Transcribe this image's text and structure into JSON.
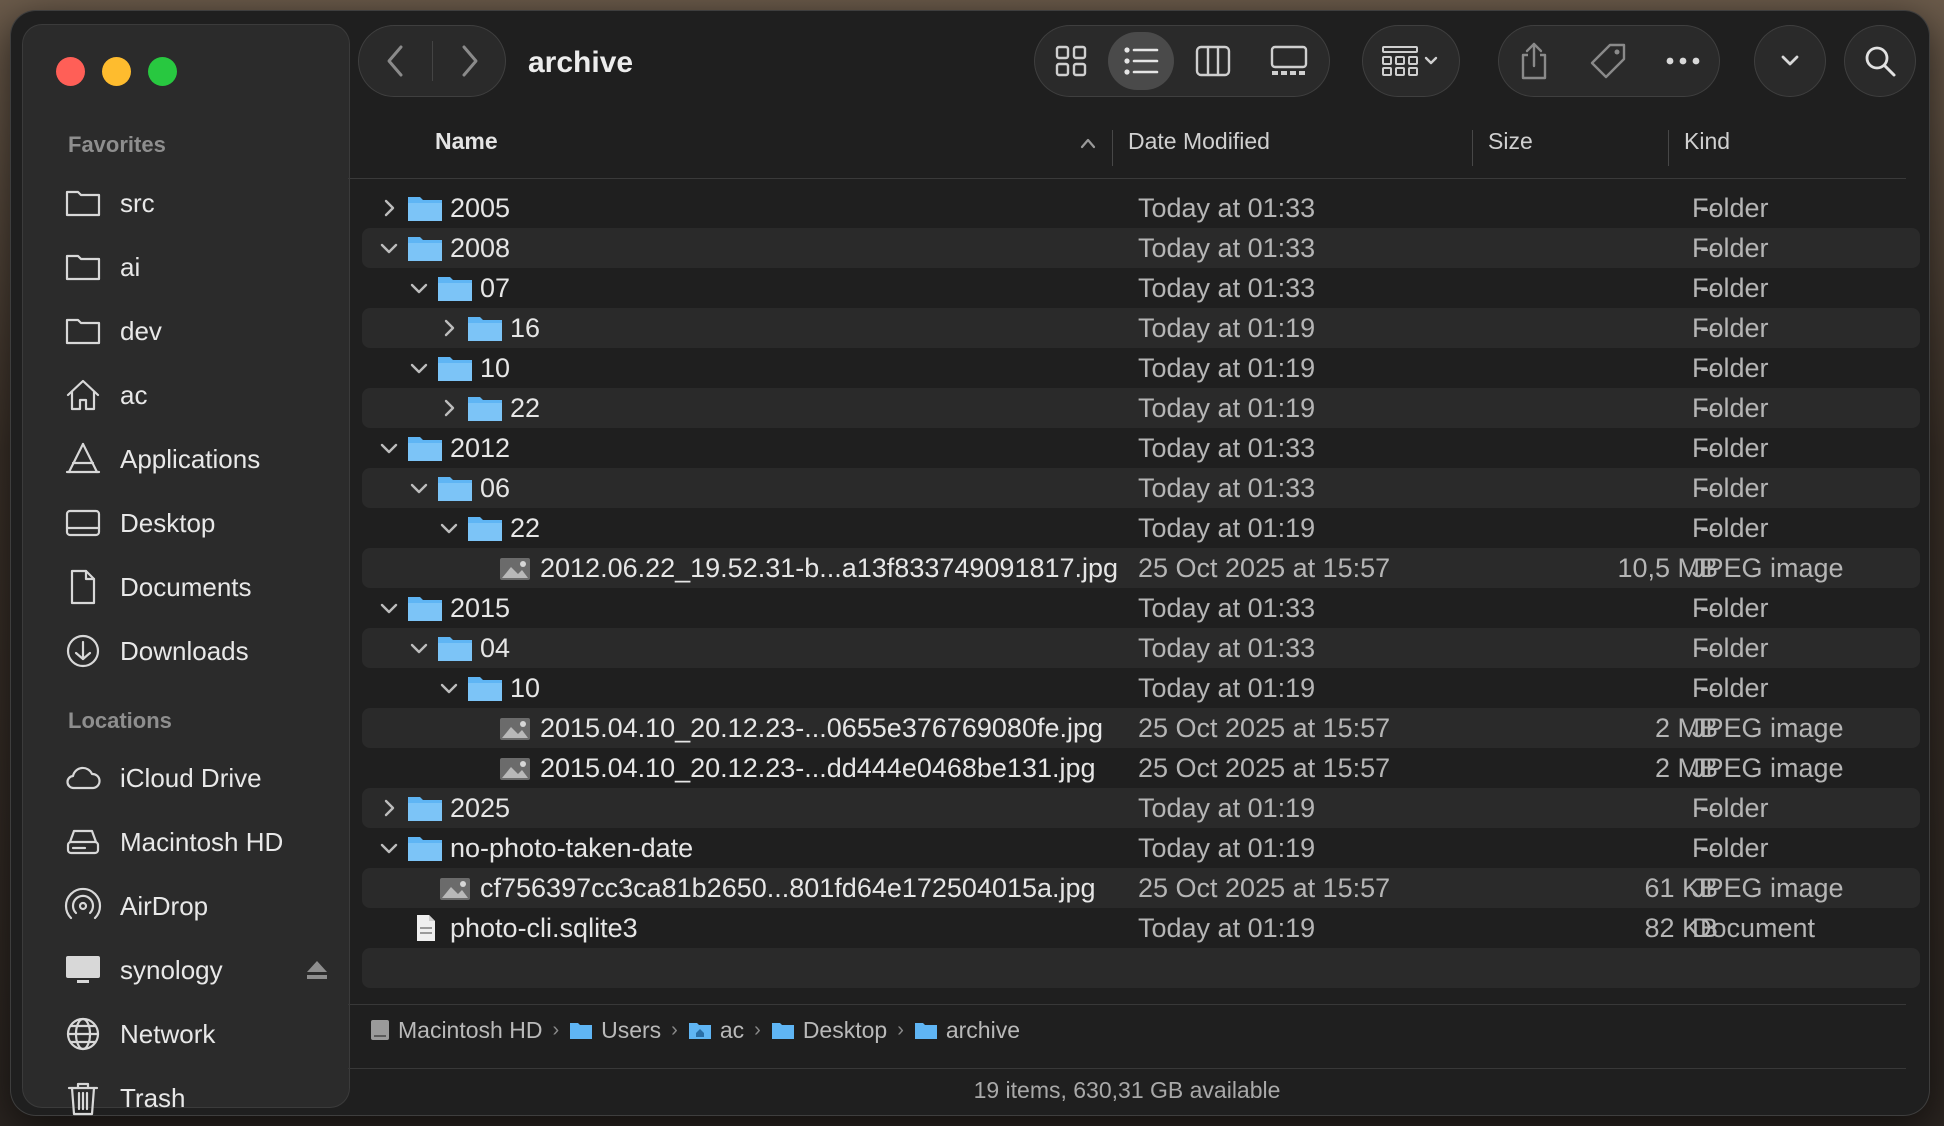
{
  "window": {
    "title": "archive"
  },
  "sidebar": {
    "favorites_label": "Favorites",
    "favorites": [
      {
        "label": "src",
        "icon": "folder-icon"
      },
      {
        "label": "ai",
        "icon": "folder-icon"
      },
      {
        "label": "dev",
        "icon": "folder-icon"
      },
      {
        "label": "ac",
        "icon": "home-icon"
      },
      {
        "label": "Applications",
        "icon": "applications-icon"
      },
      {
        "label": "Desktop",
        "icon": "desktop-icon"
      },
      {
        "label": "Documents",
        "icon": "document-icon"
      },
      {
        "label": "Downloads",
        "icon": "download-icon"
      }
    ],
    "locations_label": "Locations",
    "locations": [
      {
        "label": "iCloud Drive",
        "icon": "cloud-icon"
      },
      {
        "label": "Macintosh HD",
        "icon": "hard-drive-icon"
      },
      {
        "label": "AirDrop",
        "icon": "airdrop-icon"
      },
      {
        "label": "synology",
        "icon": "monitor-icon"
      },
      {
        "label": "Network",
        "icon": "globe-icon"
      },
      {
        "label": "Trash",
        "icon": "trash-icon"
      }
    ]
  },
  "columns": {
    "name": "Name",
    "date": "Date Modified",
    "size": "Size",
    "kind": "Kind"
  },
  "rows": [
    {
      "name": "2005",
      "date": "Today at 01:33",
      "size": "--",
      "kind": "Folder",
      "depth": 0,
      "expanded": false,
      "type": "folder"
    },
    {
      "name": "2008",
      "date": "Today at 01:33",
      "size": "--",
      "kind": "Folder",
      "depth": 0,
      "expanded": true,
      "type": "folder"
    },
    {
      "name": "07",
      "date": "Today at 01:33",
      "size": "--",
      "kind": "Folder",
      "depth": 1,
      "expanded": true,
      "type": "folder"
    },
    {
      "name": "16",
      "date": "Today at 01:19",
      "size": "--",
      "kind": "Folder",
      "depth": 2,
      "expanded": false,
      "type": "folder"
    },
    {
      "name": "10",
      "date": "Today at 01:19",
      "size": "--",
      "kind": "Folder",
      "depth": 1,
      "expanded": true,
      "type": "folder"
    },
    {
      "name": "22",
      "date": "Today at 01:19",
      "size": "--",
      "kind": "Folder",
      "depth": 2,
      "expanded": false,
      "type": "folder"
    },
    {
      "name": "2012",
      "date": "Today at 01:33",
      "size": "--",
      "kind": "Folder",
      "depth": 0,
      "expanded": true,
      "type": "folder"
    },
    {
      "name": "06",
      "date": "Today at 01:33",
      "size": "--",
      "kind": "Folder",
      "depth": 1,
      "expanded": true,
      "type": "folder"
    },
    {
      "name": "22",
      "date": "Today at 01:19",
      "size": "--",
      "kind": "Folder",
      "depth": 2,
      "expanded": true,
      "type": "folder"
    },
    {
      "name": "2012.06.22_19.52.31-b...a13f833749091817.jpg",
      "date": "25 Oct 2025 at 15:57",
      "size": "10,5 MB",
      "kind": "JPEG image",
      "depth": 3,
      "type": "image"
    },
    {
      "name": "2015",
      "date": "Today at 01:33",
      "size": "--",
      "kind": "Folder",
      "depth": 0,
      "expanded": true,
      "type": "folder"
    },
    {
      "name": "04",
      "date": "Today at 01:33",
      "size": "--",
      "kind": "Folder",
      "depth": 1,
      "expanded": true,
      "type": "folder"
    },
    {
      "name": "10",
      "date": "Today at 01:19",
      "size": "--",
      "kind": "Folder",
      "depth": 2,
      "expanded": true,
      "type": "folder"
    },
    {
      "name": "2015.04.10_20.12.23-...0655e376769080fe.jpg",
      "date": "25 Oct 2025 at 15:57",
      "size": "2 MB",
      "kind": "JPEG image",
      "depth": 3,
      "type": "image"
    },
    {
      "name": "2015.04.10_20.12.23-...dd444e0468be131.jpg",
      "date": "25 Oct 2025 at 15:57",
      "size": "2 MB",
      "kind": "JPEG image",
      "depth": 3,
      "type": "image"
    },
    {
      "name": "2025",
      "date": "Today at 01:19",
      "size": "--",
      "kind": "Folder",
      "depth": 0,
      "expanded": false,
      "type": "folder"
    },
    {
      "name": "no-photo-taken-date",
      "date": "Today at 01:19",
      "size": "--",
      "kind": "Folder",
      "depth": 0,
      "expanded": true,
      "type": "folder"
    },
    {
      "name": "cf756397cc3ca81b2650...801fd64e172504015a.jpg",
      "date": "25 Oct 2025 at 15:57",
      "size": "61 KB",
      "kind": "JPEG image",
      "depth": 1,
      "type": "image"
    },
    {
      "name": "photo-cli.sqlite3",
      "date": "Today at 01:19",
      "size": "82 KB",
      "kind": "Document",
      "depth": 0,
      "type": "document"
    }
  ],
  "pathbar": [
    "Macintosh HD",
    "Users",
    "ac",
    "Desktop",
    "archive"
  ],
  "status": "19 items, 630,31 GB available",
  "colors": {
    "folder": "#5fb5f4",
    "accent": "#3a3a3a"
  }
}
